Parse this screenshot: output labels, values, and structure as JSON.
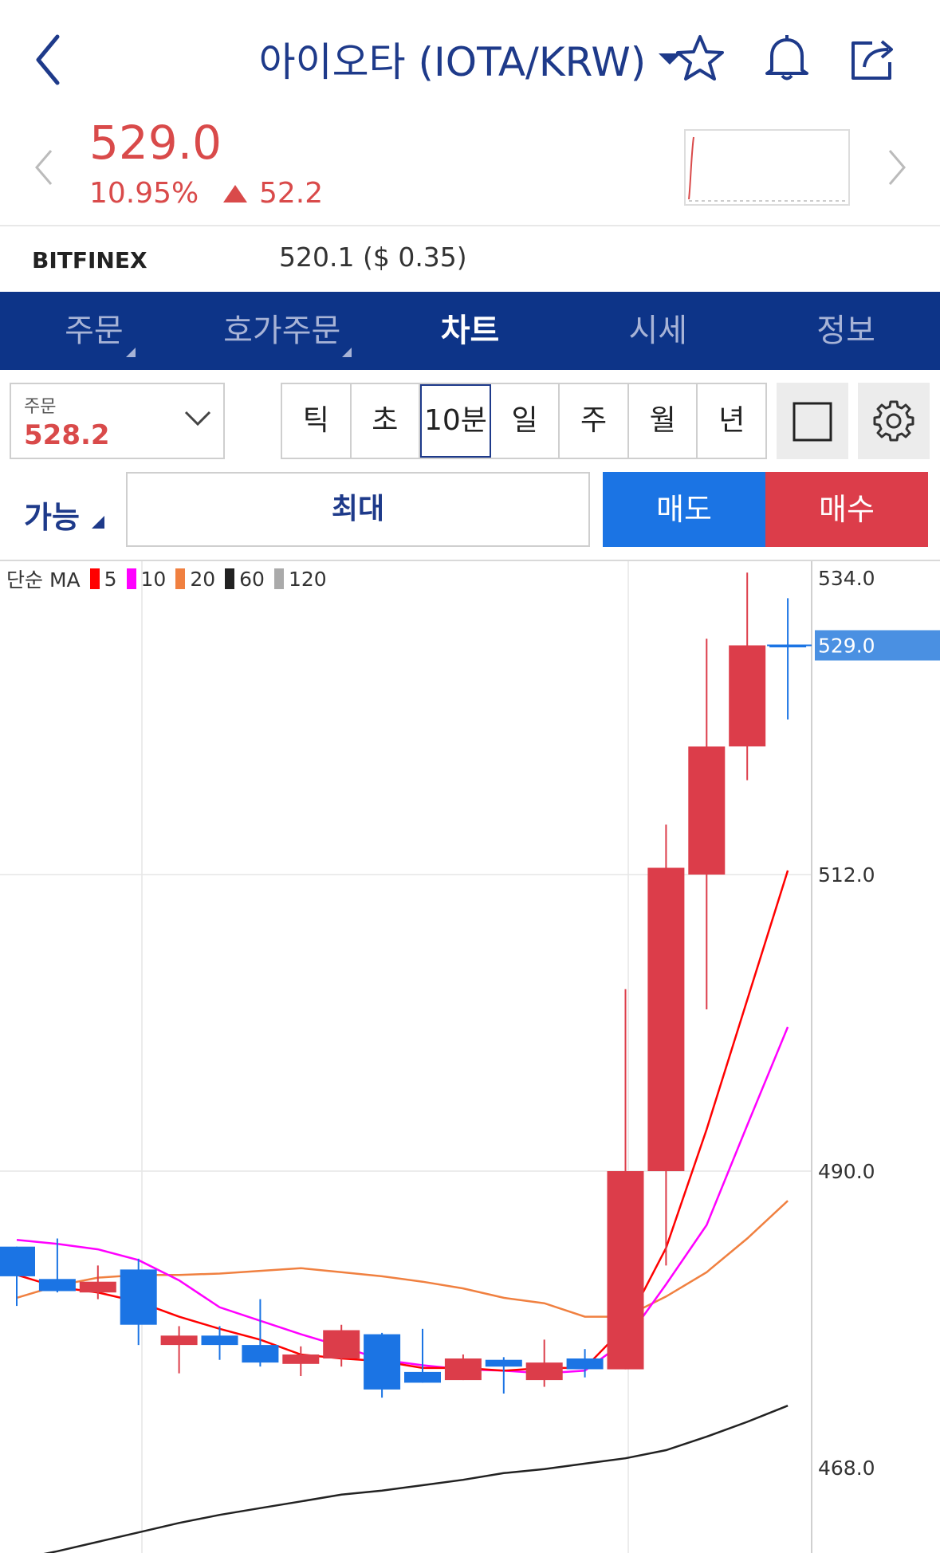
{
  "header": {
    "title": "아이오타 (IOTA/KRW)"
  },
  "price": {
    "current": "529.0",
    "change_pct": "10.95%",
    "change_abs": "52.2"
  },
  "exchange": {
    "name": "BITFINEX",
    "value": "520.1 ($ 0.35)"
  },
  "tabs": [
    {
      "label": "주문"
    },
    {
      "label": "호가주문"
    },
    {
      "label": "차트"
    },
    {
      "label": "시세"
    },
    {
      "label": "정보"
    }
  ],
  "order": {
    "label": "주문",
    "value": "528.2"
  },
  "periods": [
    "틱",
    "초",
    "10분",
    "일",
    "주",
    "월",
    "년"
  ],
  "actions": {
    "available": "가능",
    "max": "최대",
    "sell": "매도",
    "buy": "매수"
  },
  "legend": {
    "title": "단순 MA",
    "items": [
      {
        "label": "5",
        "color": "#ff0000"
      },
      {
        "label": "10",
        "color": "#ff00ff"
      },
      {
        "label": "20",
        "color": "#f08040"
      },
      {
        "label": "60",
        "color": "#222222"
      },
      {
        "label": "120",
        "color": "#aaaaaa"
      }
    ]
  },
  "colors": {
    "up": "#dc3d4a",
    "down": "#1b74e4",
    "brand": "#0d3488"
  },
  "chart_data": {
    "type": "candlestick",
    "y_ticks": [
      "534.0",
      "512.0",
      "490.0",
      "468.0"
    ],
    "ylim": [
      460,
      536
    ],
    "current_label": "529.0",
    "candles": [
      {
        "o": 484.4,
        "c": 482.2,
        "h": 484.4,
        "l": 480.0
      },
      {
        "o": 482.0,
        "c": 481.1,
        "h": 485.0,
        "l": 481.0
      },
      {
        "o": 481.0,
        "c": 481.8,
        "h": 483.0,
        "l": 480.5
      },
      {
        "o": 482.7,
        "c": 478.6,
        "h": 483.5,
        "l": 477.1
      },
      {
        "o": 477.1,
        "c": 477.8,
        "h": 478.5,
        "l": 475.0
      },
      {
        "o": 477.8,
        "c": 477.1,
        "h": 478.5,
        "l": 476.0
      },
      {
        "o": 477.1,
        "c": 475.8,
        "h": 480.5,
        "l": 475.5
      },
      {
        "o": 475.7,
        "c": 476.4,
        "h": 477.0,
        "l": 474.8
      },
      {
        "o": 476.1,
        "c": 478.2,
        "h": 478.6,
        "l": 475.5
      },
      {
        "o": 477.9,
        "c": 473.8,
        "h": 478.0,
        "l": 473.2
      },
      {
        "o": 475.1,
        "c": 474.3,
        "h": 478.3,
        "l": 474.3
      },
      {
        "o": 474.5,
        "c": 476.1,
        "h": 476.4,
        "l": 474.5
      },
      {
        "o": 476.0,
        "c": 475.5,
        "h": 476.2,
        "l": 473.5
      },
      {
        "o": 474.5,
        "c": 475.8,
        "h": 477.5,
        "l": 474.0
      },
      {
        "o": 476.1,
        "c": 475.3,
        "h": 476.8,
        "l": 474.7
      },
      {
        "o": 475.3,
        "c": 490.0,
        "h": 503.5,
        "l": 475.3
      },
      {
        "o": 490.0,
        "c": 512.5,
        "h": 515.7,
        "l": 483.0
      },
      {
        "o": 512.0,
        "c": 521.5,
        "h": 529.5,
        "l": 502.0
      },
      {
        "o": 521.5,
        "c": 529.0,
        "h": 534.4,
        "l": 519.0
      },
      {
        "o": 529.0,
        "c": 529.0,
        "h": 532.5,
        "l": 523.5
      }
    ],
    "ma5": [
      482.3,
      481.4,
      481.0,
      480.3,
      479.2,
      478.3,
      477.5,
      476.4,
      476.1,
      475.9,
      475.4,
      475.4,
      475.2,
      475.4,
      475.4,
      478.5,
      484.3,
      493.1,
      502.7,
      512.3
    ],
    "ma10": [
      484.9,
      484.6,
      484.2,
      483.4,
      481.9,
      479.9,
      478.9,
      477.9,
      477.0,
      476.0,
      475.6,
      475.3,
      475.2,
      475.0,
      475.2,
      477.4,
      481.6,
      486.0,
      493.4,
      500.7
    ],
    "ma20": [
      480.6,
      481.5,
      482.1,
      482.3,
      482.3,
      482.4,
      482.6,
      482.8,
      482.5,
      482.2,
      481.8,
      481.3,
      480.6,
      480.2,
      479.2,
      479.2,
      480.7,
      482.5,
      485.0,
      487.8
    ],
    "ma60": [
      461.2,
      461.8,
      462.5,
      463.2,
      463.9,
      464.5,
      465.0,
      465.5,
      466.0,
      466.3,
      466.7,
      467.1,
      467.6,
      467.9,
      468.3,
      468.7,
      469.3,
      470.3,
      471.4,
      472.6
    ]
  }
}
